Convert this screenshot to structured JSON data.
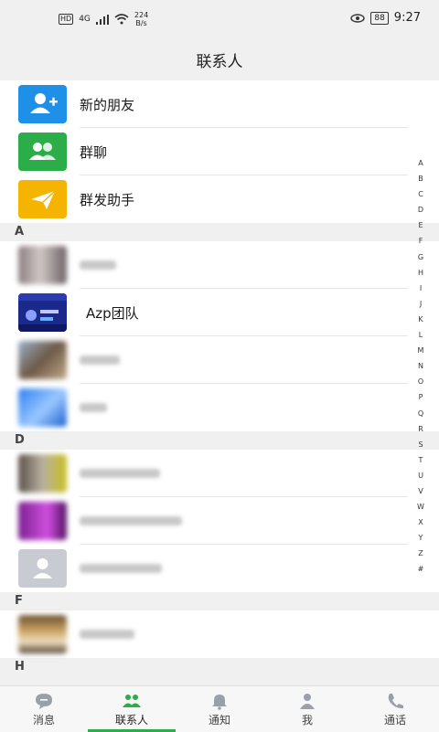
{
  "status_bar": {
    "hd": "HD",
    "network": "4G",
    "speed_value": "224",
    "speed_unit": "B/s",
    "battery": "88",
    "time": "9:27"
  },
  "header": {
    "title": "联系人"
  },
  "features": [
    {
      "label": "新的朋友",
      "icon": "add-friend-icon"
    },
    {
      "label": "群聊",
      "icon": "group-icon"
    },
    {
      "label": "群发助手",
      "icon": "paper-plane-icon"
    }
  ],
  "sections": [
    {
      "letter": "A"
    },
    {
      "letter": "D"
    },
    {
      "letter": "F"
    },
    {
      "letter": "H"
    }
  ],
  "contacts_A_visible_name": "Azp团队",
  "index_letters": [
    "A",
    "B",
    "C",
    "D",
    "E",
    "F",
    "G",
    "H",
    "I",
    "J",
    "K",
    "L",
    "M",
    "N",
    "O",
    "P",
    "Q",
    "R",
    "S",
    "T",
    "U",
    "V",
    "W",
    "X",
    "Y",
    "Z",
    "#"
  ],
  "tabs": [
    {
      "label": "消息",
      "icon": "chat-bubble-icon"
    },
    {
      "label": "联系人",
      "icon": "contacts-icon"
    },
    {
      "label": "通知",
      "icon": "bell-icon"
    },
    {
      "label": "我",
      "icon": "person-icon"
    },
    {
      "label": "通话",
      "icon": "phone-icon"
    }
  ],
  "colors": {
    "active_tab": "#2bae4a",
    "blue_icon": "#1e90e8",
    "green_icon": "#2bae4a",
    "yellow_icon": "#f5b400"
  }
}
